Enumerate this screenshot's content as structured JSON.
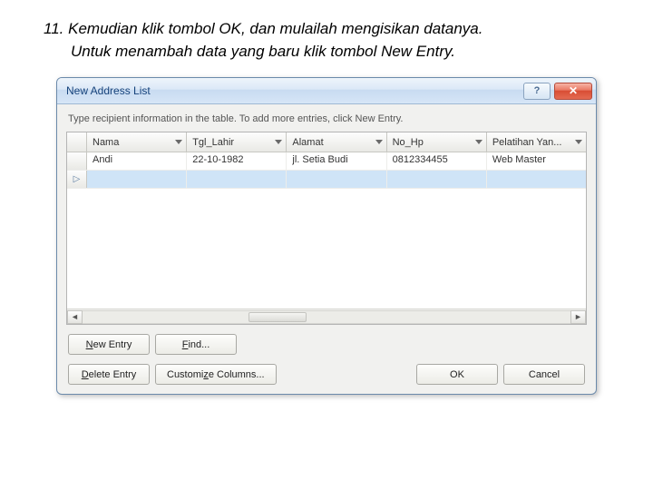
{
  "instruction": {
    "number": "11.",
    "line1": "Kemudian klik tombol OK, dan mulailah mengisikan datanya.",
    "line2": "Untuk menambah data yang baru klik tombol New Entry."
  },
  "dialog": {
    "title": "New Address List",
    "helpIcon": "?",
    "closeIcon": "✕",
    "hint": "Type recipient information in the table.  To add more entries, click New Entry.",
    "columns": [
      "Nama",
      "Tgl_Lahir",
      "Alamat",
      "No_Hp",
      "Pelatihan Yan..."
    ],
    "rows": [
      {
        "cells": [
          "Andi",
          "22-10-1982",
          "jl. Setia Budi",
          "0812334455",
          "Web Master"
        ]
      }
    ],
    "buttons": {
      "newEntry": "New Entry",
      "find": "Find...",
      "deleteEntry": "Delete Entry",
      "customize": "Customize Columns...",
      "ok": "OK",
      "cancel": "Cancel"
    }
  }
}
